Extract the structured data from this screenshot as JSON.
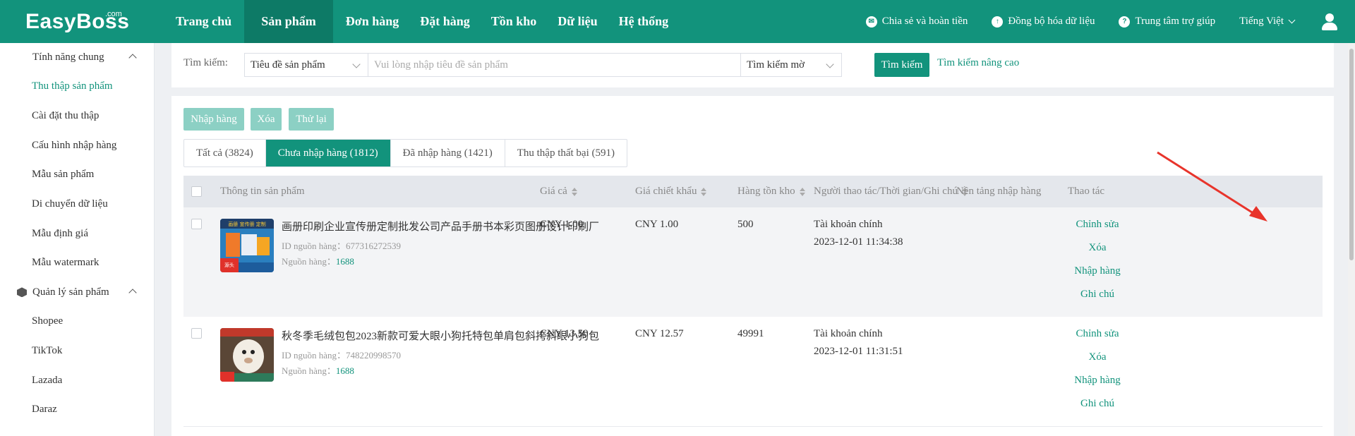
{
  "brand": {
    "name": "EasyBoss",
    "suffix": ".com"
  },
  "nav": {
    "items": [
      "Trang chủ",
      "Sản phẩm",
      "Đơn hàng",
      "Đặt hàng",
      "Tồn kho",
      "Dữ liệu",
      "Hệ thống"
    ],
    "active": "Sản phẩm"
  },
  "top_right": {
    "share": "Chia sẻ và hoàn tiền",
    "sync": "Đồng bộ hóa dữ liệu",
    "help": "Trung tâm trợ giúp",
    "language": "Tiếng Việt"
  },
  "sidebar": {
    "groups": [
      {
        "label": "Tính năng chung",
        "icon": "grid-icon",
        "items": [
          "Thu thập sản phẩm",
          "Cài đặt thu thập",
          "Cấu hình nhập hàng",
          "Mẫu sản phẩm",
          "Di chuyển dữ liệu",
          "Mẫu định giá",
          "Mẫu watermark"
        ]
      },
      {
        "label": "Quản lý sản phẩm",
        "icon": "box-icon",
        "items": [
          "Shopee",
          "TikTok",
          "Lazada",
          "Daraz"
        ]
      }
    ],
    "active_item": "Thu thập sản phẩm"
  },
  "search": {
    "label": "Tìm kiếm:",
    "field_select": "Tiêu đề sản phẩm",
    "placeholder": "Vui lòng nhập tiêu đề sản phẩm",
    "mode_select": "Tìm kiếm mờ",
    "button": "Tìm kiếm",
    "advanced": "Tìm kiếm nâng cao"
  },
  "actions": [
    "Nhập hàng",
    "Xóa",
    "Thử lại"
  ],
  "tabs": [
    {
      "label": "Tất cả (3824)"
    },
    {
      "label": "Chưa nhập hàng (1812)"
    },
    {
      "label": "Đã nhập hàng (1421)"
    },
    {
      "label": "Thu thập thất bại (591)"
    }
  ],
  "active_tab": "Chưa nhập hàng (1812)",
  "table": {
    "headers": {
      "product": "Thông tin sản phẩm",
      "price": "Giá cả",
      "discount": "Giá chiết khẩu",
      "stock": "Hàng tồn kho",
      "operator": "Người thao tác/Thời gian/Ghi chú",
      "platform": "Nền tảng nhập hàng",
      "actions": "Thao tác"
    },
    "id_label": "ID nguồn hàng：",
    "source_label": "Nguồn hàng：",
    "rows": [
      {
        "title": "画册印刷企业宣传册定制批发公司产品手册书本彩页图册设计印刷厂",
        "source_id": "677316272539",
        "source": "1688",
        "price": "CNY 1.00",
        "discount": "CNY 1.00",
        "stock": "500",
        "operator": "Tài khoản chính",
        "time": "2023-12-01 11:34:38",
        "ops": [
          "Chỉnh sửa",
          "Xóa",
          "Nhập hàng",
          "Ghi chú"
        ]
      },
      {
        "title": "秋冬季毛绒包包2023新款可爱大眼小狗托特包单肩包斜挎斜眼小狗包",
        "source_id": "748220998570",
        "source": "1688",
        "price": "CNY 13.50",
        "discount": "CNY 12.57",
        "stock": "49991",
        "operator": "Tài khoản chính",
        "time": "2023-12-01 11:31:51",
        "ops": [
          "Chỉnh sửa",
          "Xóa",
          "Nhập hàng",
          "Ghi chú"
        ]
      }
    ]
  },
  "colors": {
    "primary": "#12937c",
    "primary_dark": "#0d7a66",
    "annotation": "#e8342b",
    "disabled_btn": "#8cd0c4"
  }
}
